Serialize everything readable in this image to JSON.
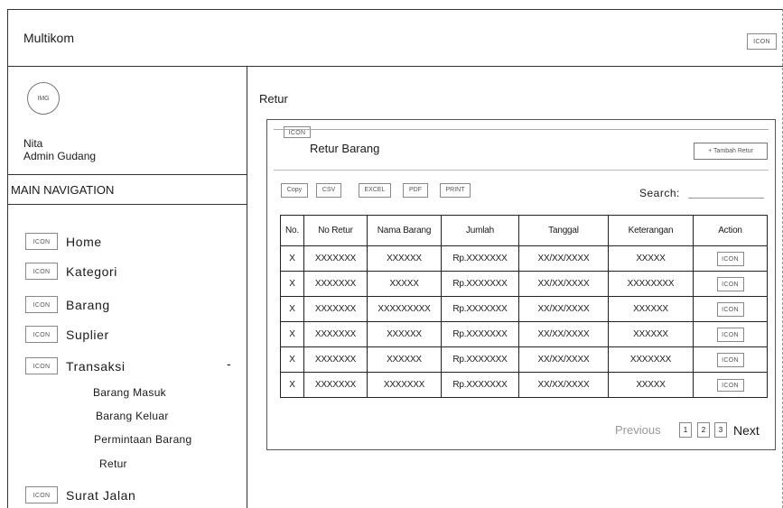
{
  "header": {
    "app_title": "Multikom",
    "icon_label": "ICON"
  },
  "sidebar": {
    "avatar_label": "IMG",
    "user_name": "Nita",
    "user_role": "Admin Gudang",
    "nav_heading": "MAIN NAVIGATION",
    "icon_label": "ICON",
    "items": [
      {
        "label": "Home"
      },
      {
        "label": "Kategori"
      },
      {
        "label": "Barang"
      },
      {
        "label": "Suplier"
      },
      {
        "label": "Transaksi",
        "toggle": "-"
      },
      {
        "label": "Surat Jalan"
      }
    ],
    "sub_items": [
      {
        "label": "Barang Masuk"
      },
      {
        "label": "Barang Keluar"
      },
      {
        "label": "Permintaan Barang"
      },
      {
        "label": "Retur"
      }
    ]
  },
  "main": {
    "page_title": "Retur",
    "panel": {
      "icon_label": "ICON",
      "title": "Retur Barang",
      "add_button": "+ Tambah Retur",
      "export_buttons": [
        "Copy",
        "CSV",
        "EXCEL",
        "PDF",
        "PRINT"
      ],
      "search_label": "Search:"
    },
    "table": {
      "headers": [
        "No.",
        "No Retur",
        "Nama Barang",
        "Jumlah",
        "Tanggal",
        "Keterangan",
        "Action"
      ],
      "action_label": "ICON",
      "rows": [
        [
          "X",
          "XXXXXXX",
          "XXXXXX",
          "Rp.XXXXXXX",
          "XX/XX/XXXX",
          "XXXXX"
        ],
        [
          "X",
          "XXXXXXX",
          "XXXXX",
          "Rp.XXXXXXX",
          "XX/XX/XXXX",
          "XXXXXXXX"
        ],
        [
          "X",
          "XXXXXXX",
          "XXXXXXXXX",
          "Rp.XXXXXXX",
          "XX/XX/XXXX",
          "XXXXXX"
        ],
        [
          "X",
          "XXXXXXX",
          "XXXXXX",
          "Rp.XXXXXXX",
          "XX/XX/XXXX",
          "XXXXXX"
        ],
        [
          "X",
          "XXXXXXX",
          "XXXXXX",
          "Rp.XXXXXXX",
          "XX/XX/XXXX",
          "XXXXXXX"
        ],
        [
          "X",
          "XXXXXXX",
          "XXXXXXX",
          "Rp.XXXXXXX",
          "XX/XX/XXXX",
          "XXXXX"
        ]
      ]
    },
    "pagination": {
      "previous": "Previous",
      "pages": [
        "1",
        "2",
        "3"
      ],
      "next": "Next"
    }
  }
}
